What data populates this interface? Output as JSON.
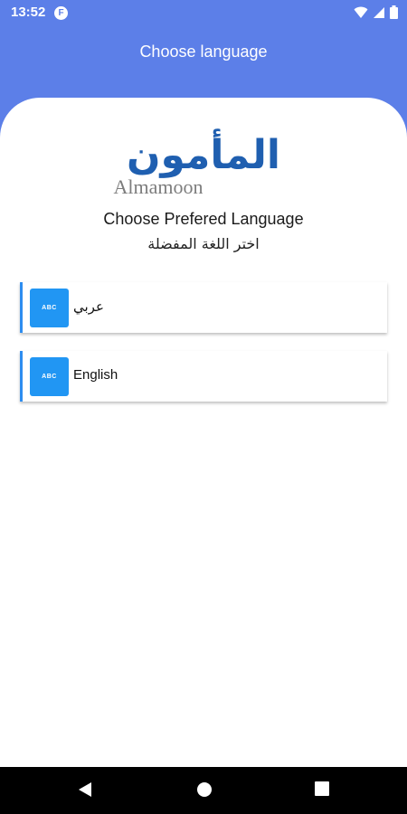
{
  "status_bar": {
    "time": "13:52",
    "app_icon_letter": "F",
    "icons": [
      "wifi-icon",
      "signal-icon",
      "battery-icon"
    ]
  },
  "header": {
    "title": "Choose language"
  },
  "logo": {
    "arabic_text": "المأمون",
    "latin_text": "Almamoon"
  },
  "main": {
    "heading": "Choose Prefered Language",
    "subheading": "اختر اللغة المفضلة",
    "languages": [
      {
        "badge": "ABC",
        "label": "عربي"
      },
      {
        "badge": "ABC",
        "label": "English"
      }
    ]
  },
  "nav_bar": {
    "buttons": [
      "back-icon",
      "home-icon",
      "recents-icon"
    ]
  },
  "colors": {
    "header": "#5c7fe8",
    "badge": "#2196f3",
    "logo_blue": "#1f5fb0",
    "logo_gray": "#7d7d7d"
  }
}
